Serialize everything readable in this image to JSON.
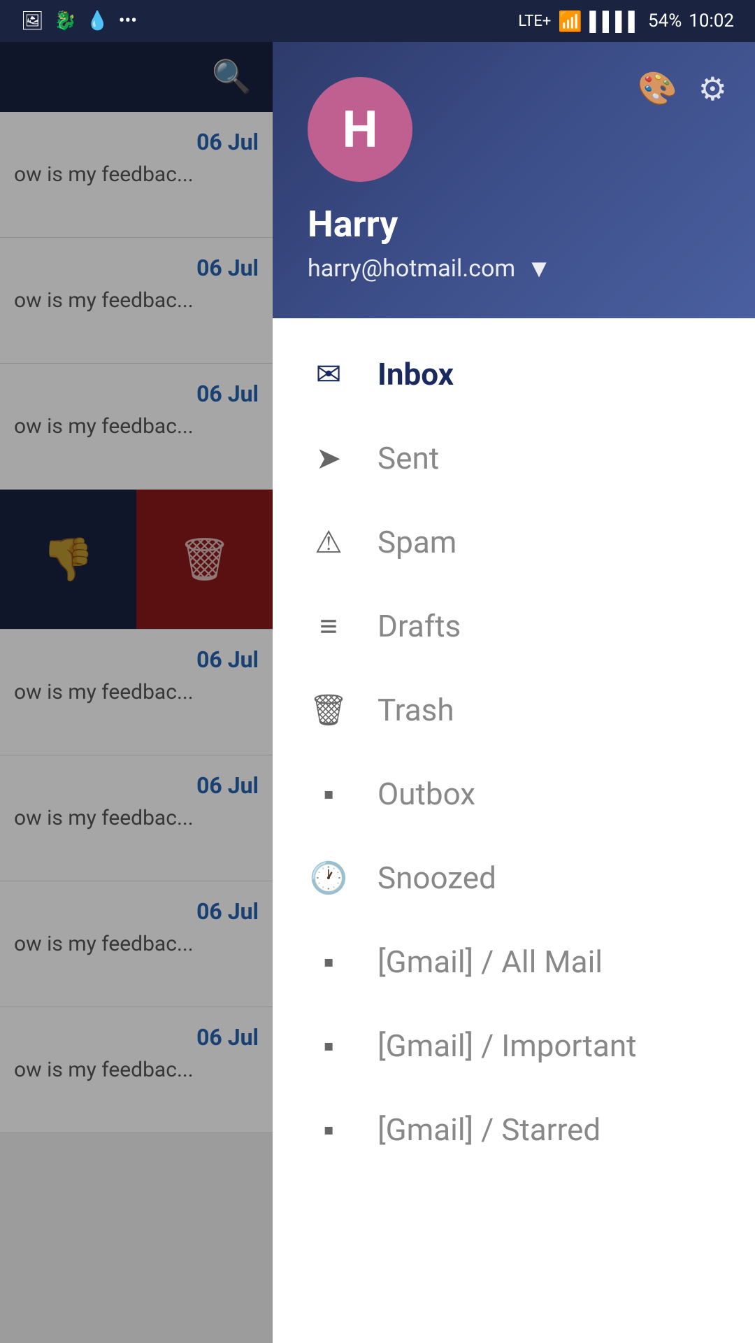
{
  "statusBar": {
    "leftIcons": [
      "image-icon",
      "dragon-icon",
      "drop-icon",
      "more-icon"
    ],
    "signal": "LTE+",
    "wifi": "wifi",
    "bars": "4",
    "battery": "54%",
    "time": "10:02"
  },
  "drawer": {
    "headerIconPalette": "🎨",
    "headerIconSettings": "⚙",
    "avatar": {
      "initial": "H",
      "bgColor": "#c06090"
    },
    "userName": "Harry",
    "userEmail": "harry@hotmail.com",
    "chevronLabel": "▼",
    "navItems": [
      {
        "id": "inbox",
        "label": "Inbox",
        "icon": "✉",
        "active": true
      },
      {
        "id": "sent",
        "label": "Sent",
        "icon": "➤",
        "active": false
      },
      {
        "id": "spam",
        "label": "Spam",
        "icon": "⚠",
        "active": false
      },
      {
        "id": "drafts",
        "label": "Drafts",
        "icon": "📋",
        "active": false
      },
      {
        "id": "trash",
        "label": "Trash",
        "icon": "🗑",
        "active": false
      },
      {
        "id": "outbox",
        "label": "Outbox",
        "icon": "📁",
        "active": false
      },
      {
        "id": "snoozed",
        "label": "Snoozed",
        "icon": "🕐",
        "active": false
      },
      {
        "id": "gmail-all",
        "label": "[Gmail] / All Mail",
        "icon": "📁",
        "active": false
      },
      {
        "id": "gmail-imp",
        "label": "[Gmail] / Important",
        "icon": "📁",
        "active": false
      },
      {
        "id": "gmail-starred",
        "label": "[Gmail] / Starred",
        "icon": "📁",
        "active": false
      }
    ]
  },
  "emailList": {
    "items": [
      {
        "date": "06 Jul",
        "preview": "ow is my feedbac..."
      },
      {
        "date": "06 Jul",
        "preview": "ow is my feedbac..."
      },
      {
        "date": "06 Jul",
        "preview": "ow is my feedbac..."
      },
      {
        "date": "06 Jul",
        "preview": "ow is my feedbac..."
      },
      {
        "date": "06 Jul",
        "preview": "ow is my feedbac..."
      },
      {
        "date": "06 Jul",
        "preview": "ow is my feedbac..."
      },
      {
        "date": "06 Jul",
        "preview": "ow is my feedbac..."
      }
    ],
    "swipePosition": 3
  }
}
